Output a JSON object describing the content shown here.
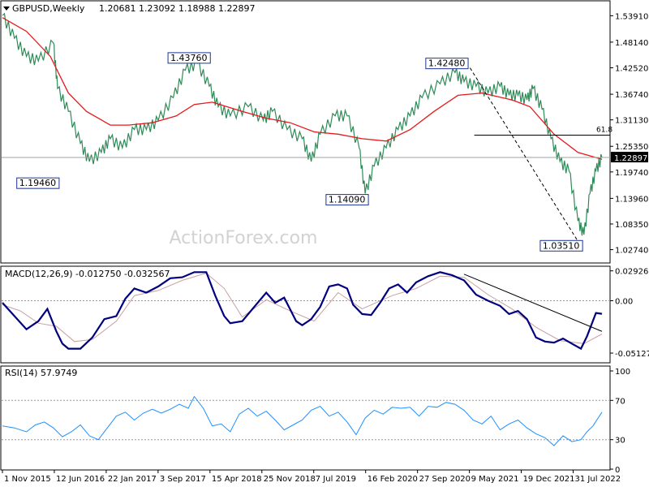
{
  "chart_data": [
    {
      "type": "line",
      "title": "GBPUSD,Weekly",
      "ohlc_header": "1.20681 1.23092 1.18988 1.22897",
      "current_price": 1.22897,
      "ylim": [
        1.0,
        1.57
      ],
      "y_ticks": [
        "1.53910",
        "1.48140",
        "1.42520",
        "1.36740",
        "1.31130",
        "1.25350",
        "1.19740",
        "1.13960",
        "1.08350",
        "1.02740"
      ],
      "x_ticks": [
        "1 Nov 2015",
        "12 Jun 2016",
        "22 Jan 2017",
        "3 Sep 2017",
        "15 Apr 2018",
        "25 Nov 2018",
        "7 Jul 2019",
        "16 Feb 2020",
        "27 Sep 2020",
        "9 May 2021",
        "19 Dec 2021",
        "31 Jul 2022"
      ],
      "price_path": [
        [
          0,
          1.54
        ],
        [
          0.02,
          1.49
        ],
        [
          0.04,
          1.45
        ],
        [
          0.06,
          1.44
        ],
        [
          0.085,
          1.48
        ],
        [
          0.092,
          1.38
        ],
        [
          0.11,
          1.33
        ],
        [
          0.13,
          1.26
        ],
        [
          0.145,
          1.22
        ],
        [
          0.165,
          1.24
        ],
        [
          0.18,
          1.27
        ],
        [
          0.2,
          1.25
        ],
        [
          0.22,
          1.29
        ],
        [
          0.24,
          1.29
        ],
        [
          0.26,
          1.31
        ],
        [
          0.285,
          1.36
        ],
        [
          0.305,
          1.42
        ],
        [
          0.325,
          1.435
        ],
        [
          0.345,
          1.385
        ],
        [
          0.36,
          1.34
        ],
        [
          0.38,
          1.32
        ],
        [
          0.41,
          1.34
        ],
        [
          0.435,
          1.31
        ],
        [
          0.45,
          1.33
        ],
        [
          0.475,
          1.29
        ],
        [
          0.5,
          1.27
        ],
        [
          0.515,
          1.22
        ],
        [
          0.53,
          1.28
        ],
        [
          0.555,
          1.32
        ],
        [
          0.575,
          1.32
        ],
        [
          0.595,
          1.25
        ],
        [
          0.605,
          1.15
        ],
        [
          0.62,
          1.21
        ],
        [
          0.64,
          1.25
        ],
        [
          0.66,
          1.29
        ],
        [
          0.68,
          1.32
        ],
        [
          0.7,
          1.36
        ],
        [
          0.73,
          1.39
        ],
        [
          0.755,
          1.415
        ],
        [
          0.77,
          1.395
        ],
        [
          0.79,
          1.385
        ],
        [
          0.81,
          1.37
        ],
        [
          0.83,
          1.385
        ],
        [
          0.845,
          1.365
        ],
        [
          0.86,
          1.365
        ],
        [
          0.875,
          1.355
        ],
        [
          0.885,
          1.38
        ],
        [
          0.9,
          1.335
        ],
        [
          0.915,
          1.27
        ],
        [
          0.93,
          1.22
        ],
        [
          0.945,
          1.2
        ],
        [
          0.96,
          1.09
        ],
        [
          0.97,
          1.06
        ],
        [
          0.98,
          1.15
        ],
        [
          0.99,
          1.2
        ],
        [
          1,
          1.229
        ]
      ],
      "ma_path": [
        [
          0,
          1.535
        ],
        [
          0.04,
          1.505
        ],
        [
          0.08,
          1.45
        ],
        [
          0.11,
          1.37
        ],
        [
          0.14,
          1.33
        ],
        [
          0.18,
          1.3
        ],
        [
          0.21,
          1.3
        ],
        [
          0.25,
          1.305
        ],
        [
          0.29,
          1.32
        ],
        [
          0.32,
          1.345
        ],
        [
          0.35,
          1.35
        ],
        [
          0.4,
          1.33
        ],
        [
          0.44,
          1.315
        ],
        [
          0.48,
          1.305
        ],
        [
          0.52,
          1.285
        ],
        [
          0.56,
          1.28
        ],
        [
          0.6,
          1.27
        ],
        [
          0.64,
          1.265
        ],
        [
          0.68,
          1.29
        ],
        [
          0.72,
          1.33
        ],
        [
          0.76,
          1.365
        ],
        [
          0.8,
          1.37
        ],
        [
          0.85,
          1.355
        ],
        [
          0.88,
          1.34
        ],
        [
          0.92,
          1.28
        ],
        [
          0.96,
          1.24
        ],
        [
          1,
          1.225
        ]
      ],
      "annotations": [
        {
          "text": "1.43760",
          "x": 0.325,
          "y": 1.437
        },
        {
          "text": "1.19460",
          "x": 0.1,
          "y": 1.195
        },
        {
          "text": "1.14090",
          "x": 0.605,
          "y": 1.141
        },
        {
          "text": "1.42480",
          "x": 0.755,
          "y": 1.425
        },
        {
          "text": "1.03510",
          "x": 0.965,
          "y": 1.035
        }
      ],
      "fib_label": "61.8",
      "fib_level": 1.278,
      "trendline": [
        [
          0.78,
          1.425
        ],
        [
          0.965,
          1.035
        ]
      ],
      "watermark": "ActionForex.com"
    },
    {
      "type": "line",
      "title": "MACD(12,26,9) -0.012750 -0.032567",
      "ylim": [
        -0.06,
        0.033
      ],
      "y_ticks": [
        "0.029261",
        "0.00",
        "-0.051279"
      ],
      "zero_level": 0,
      "macd_path": [
        [
          0,
          -0.002
        ],
        [
          0.02,
          -0.015
        ],
        [
          0.04,
          -0.028
        ],
        [
          0.06,
          -0.02
        ],
        [
          0.075,
          -0.008
        ],
        [
          0.09,
          -0.03
        ],
        [
          0.1,
          -0.042
        ],
        [
          0.11,
          -0.047
        ],
        [
          0.13,
          -0.047
        ],
        [
          0.15,
          -0.036
        ],
        [
          0.17,
          -0.018
        ],
        [
          0.19,
          -0.015
        ],
        [
          0.205,
          0.002
        ],
        [
          0.22,
          0.012
        ],
        [
          0.24,
          0.008
        ],
        [
          0.26,
          0.014
        ],
        [
          0.28,
          0.022
        ],
        [
          0.3,
          0.023
        ],
        [
          0.32,
          0.028
        ],
        [
          0.34,
          0.028
        ],
        [
          0.355,
          0.005
        ],
        [
          0.37,
          -0.015
        ],
        [
          0.38,
          -0.022
        ],
        [
          0.4,
          -0.02
        ],
        [
          0.42,
          -0.006
        ],
        [
          0.44,
          0.008
        ],
        [
          0.455,
          -0.002
        ],
        [
          0.47,
          0.003
        ],
        [
          0.49,
          -0.02
        ],
        [
          0.5,
          -0.024
        ],
        [
          0.515,
          -0.018
        ],
        [
          0.53,
          -0.006
        ],
        [
          0.545,
          0.014
        ],
        [
          0.56,
          0.016
        ],
        [
          0.575,
          0.012
        ],
        [
          0.585,
          -0.004
        ],
        [
          0.6,
          -0.013
        ],
        [
          0.615,
          -0.014
        ],
        [
          0.63,
          -0.002
        ],
        [
          0.645,
          0.012
        ],
        [
          0.66,
          0.016
        ],
        [
          0.675,
          0.008
        ],
        [
          0.69,
          0.018
        ],
        [
          0.71,
          0.024
        ],
        [
          0.73,
          0.028
        ],
        [
          0.75,
          0.025
        ],
        [
          0.77,
          0.02
        ],
        [
          0.79,
          0.006
        ],
        [
          0.81,
          0.0
        ],
        [
          0.83,
          -0.005
        ],
        [
          0.845,
          -0.013
        ],
        [
          0.86,
          -0.01
        ],
        [
          0.875,
          -0.018
        ],
        [
          0.89,
          -0.036
        ],
        [
          0.905,
          -0.04
        ],
        [
          0.92,
          -0.041
        ],
        [
          0.935,
          -0.037
        ],
        [
          0.95,
          -0.042
        ],
        [
          0.965,
          -0.047
        ],
        [
          0.975,
          -0.035
        ],
        [
          0.99,
          -0.012
        ],
        [
          1,
          -0.0128
        ]
      ],
      "signal_path": [
        [
          0,
          -0.004
        ],
        [
          0.03,
          -0.01
        ],
        [
          0.06,
          -0.022
        ],
        [
          0.09,
          -0.025
        ],
        [
          0.12,
          -0.04
        ],
        [
          0.15,
          -0.038
        ],
        [
          0.19,
          -0.02
        ],
        [
          0.22,
          0.005
        ],
        [
          0.26,
          0.01
        ],
        [
          0.3,
          0.02
        ],
        [
          0.34,
          0.027
        ],
        [
          0.37,
          0.012
        ],
        [
          0.4,
          -0.016
        ],
        [
          0.44,
          0.001
        ],
        [
          0.48,
          -0.01
        ],
        [
          0.52,
          -0.02
        ],
        [
          0.56,
          0.008
        ],
        [
          0.6,
          -0.008
        ],
        [
          0.65,
          0.005
        ],
        [
          0.69,
          0.012
        ],
        [
          0.73,
          0.024
        ],
        [
          0.77,
          0.023
        ],
        [
          0.81,
          0.006
        ],
        [
          0.85,
          -0.008
        ],
        [
          0.89,
          -0.026
        ],
        [
          0.93,
          -0.039
        ],
        [
          0.97,
          -0.042
        ],
        [
          1,
          -0.0326
        ]
      ],
      "trendline": [
        [
          0.77,
          0.026
        ],
        [
          1,
          -0.03
        ]
      ]
    },
    {
      "type": "line",
      "title": "RSI(14) 57.9749",
      "ylim": [
        0,
        100
      ],
      "y_ticks": [
        "100",
        "70",
        "30",
        "0"
      ],
      "levels": [
        70,
        30
      ],
      "rsi_path": [
        [
          0,
          44
        ],
        [
          0.02,
          42
        ],
        [
          0.04,
          38
        ],
        [
          0.055,
          45
        ],
        [
          0.07,
          48
        ],
        [
          0.085,
          42
        ],
        [
          0.1,
          33
        ],
        [
          0.115,
          38
        ],
        [
          0.13,
          45
        ],
        [
          0.145,
          34
        ],
        [
          0.16,
          30
        ],
        [
          0.175,
          42
        ],
        [
          0.19,
          54
        ],
        [
          0.205,
          58
        ],
        [
          0.22,
          50
        ],
        [
          0.235,
          57
        ],
        [
          0.25,
          61
        ],
        [
          0.265,
          57
        ],
        [
          0.28,
          61
        ],
        [
          0.295,
          66
        ],
        [
          0.31,
          62
        ],
        [
          0.32,
          74
        ],
        [
          0.335,
          62
        ],
        [
          0.35,
          44
        ],
        [
          0.365,
          46
        ],
        [
          0.38,
          38
        ],
        [
          0.395,
          56
        ],
        [
          0.41,
          62
        ],
        [
          0.425,
          54
        ],
        [
          0.44,
          59
        ],
        [
          0.455,
          50
        ],
        [
          0.47,
          40
        ],
        [
          0.485,
          45
        ],
        [
          0.5,
          50
        ],
        [
          0.515,
          60
        ],
        [
          0.53,
          64
        ],
        [
          0.545,
          54
        ],
        [
          0.56,
          58
        ],
        [
          0.575,
          48
        ],
        [
          0.59,
          35
        ],
        [
          0.605,
          52
        ],
        [
          0.62,
          60
        ],
        [
          0.635,
          56
        ],
        [
          0.65,
          63
        ],
        [
          0.665,
          62
        ],
        [
          0.68,
          63
        ],
        [
          0.695,
          54
        ],
        [
          0.71,
          64
        ],
        [
          0.725,
          63
        ],
        [
          0.74,
          68
        ],
        [
          0.755,
          66
        ],
        [
          0.77,
          60
        ],
        [
          0.785,
          50
        ],
        [
          0.8,
          46
        ],
        [
          0.815,
          54
        ],
        [
          0.83,
          40
        ],
        [
          0.845,
          46
        ],
        [
          0.86,
          50
        ],
        [
          0.875,
          42
        ],
        [
          0.89,
          36
        ],
        [
          0.905,
          32
        ],
        [
          0.92,
          24
        ],
        [
          0.935,
          34
        ],
        [
          0.95,
          28
        ],
        [
          0.965,
          30
        ],
        [
          0.975,
          38
        ],
        [
          0.985,
          44
        ],
        [
          1,
          58
        ]
      ]
    }
  ]
}
